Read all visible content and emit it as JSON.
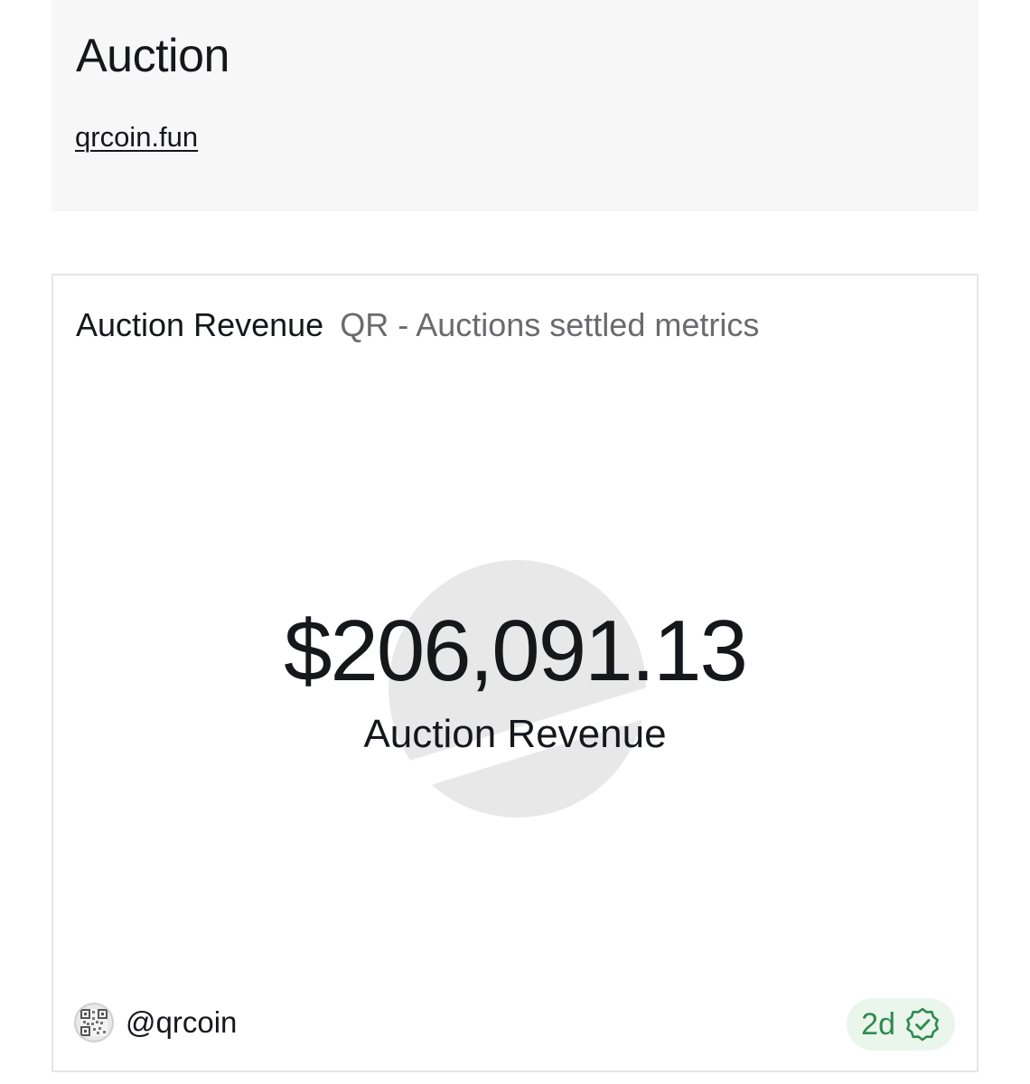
{
  "header": {
    "title": "Auction",
    "link_text": "qrcoin.fun"
  },
  "metric_card": {
    "title": "Auction Revenue",
    "subtitle": "QR - Auctions settled metrics",
    "value": "$206,091.13",
    "label": "Auction Revenue",
    "watermark_icon": "dune-logo-icon",
    "footer": {
      "avatar_icon": "qr-code-avatar-icon",
      "username": "@qrcoin",
      "age": "2d",
      "status_icon": "verified-badge-icon"
    }
  },
  "colors": {
    "header_bg": "#f7f7f7",
    "card_border": "#e6e6e6",
    "subtitle": "#6b6b6e",
    "badge_bg": "#eaf6ec",
    "badge_text": "#2f8a4e",
    "watermark": "#e8e8e8"
  }
}
